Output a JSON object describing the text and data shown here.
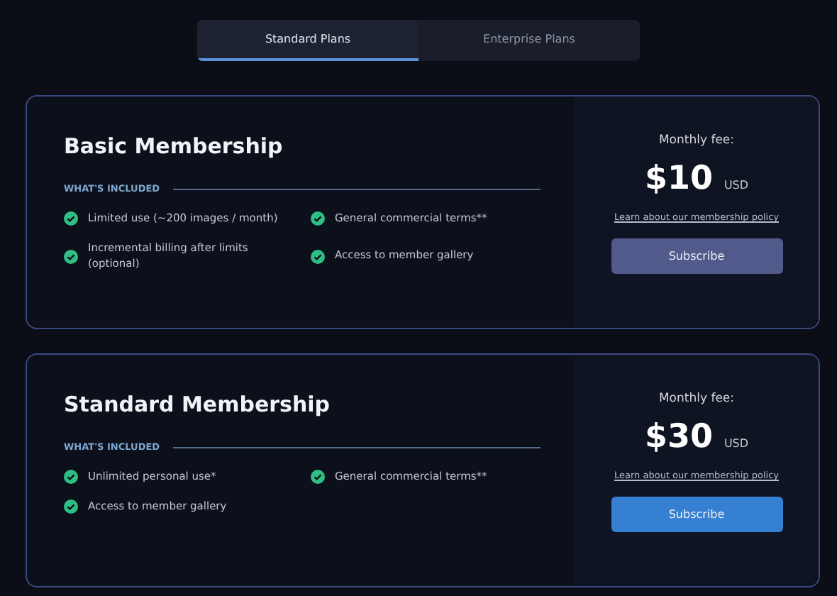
{
  "tabs": [
    {
      "label": "Standard Plans",
      "selected": true
    },
    {
      "label": "Enterprise Plans",
      "selected": false
    }
  ],
  "plans": [
    {
      "name": "Basic Membership",
      "section_label": "WHAT'S INCLUDED",
      "features": [
        "Limited use (~200 images / month)",
        "General commercial terms**",
        "Incremental billing after limits (optional)",
        "Access to member gallery"
      ],
      "fee_label": "Monthly fee:",
      "price": "$10",
      "currency": "USD",
      "policy_link": "Learn about our membership policy",
      "button": "Subscribe",
      "color": "#525a8c"
    },
    {
      "name": "Standard Membership",
      "section_label": "WHAT'S INCLUDED",
      "features": [
        "Unlimited personal use*",
        "General commercial terms**",
        "Access to member gallery"
      ],
      "fee_label": "Monthly fee:",
      "price": "$30",
      "currency": "USD",
      "policy_link": "Learn about our membership policy",
      "button": "Subscribe",
      "color": "#3580d2"
    }
  ]
}
